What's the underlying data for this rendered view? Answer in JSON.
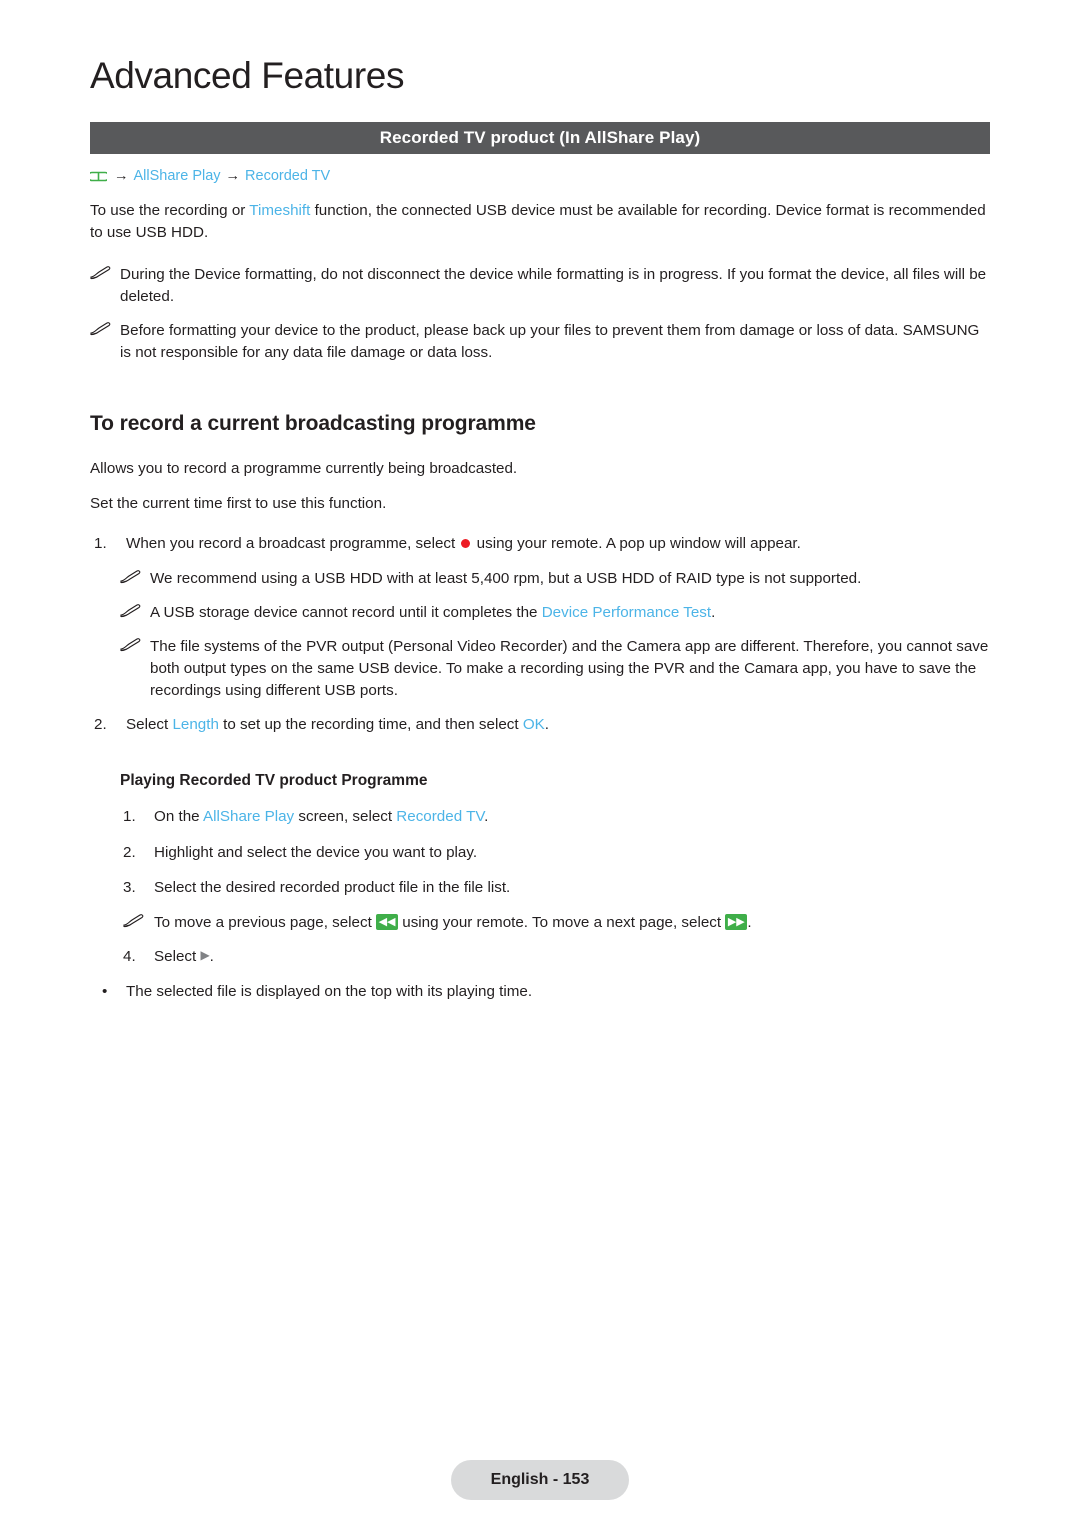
{
  "chapter": {
    "title": "Advanced Features"
  },
  "section": {
    "title": "Recorded TV product (In AllShare Play)"
  },
  "breadcrumb": {
    "icon": "menu-icon",
    "arrow1": "→",
    "item1": "AllShare Play",
    "arrow2": "→",
    "item2": "Recorded TV"
  },
  "intro": {
    "t1": "To use the recording or ",
    "link1": "Timeshift",
    "t2": " function, the connected USB device must be available for recording. Device format is recommended to use USB HDD."
  },
  "notes_top": [
    {
      "text": "During the Device formatting, do not disconnect the device while formatting is in progress. If you format the device, all files will be deleted."
    },
    {
      "text": "Before formatting your device to the product, please back up your files to prevent them from damage or loss of data. SAMSUNG is not responsible for any data file damage or data loss."
    }
  ],
  "record_section": {
    "heading": "To record a current broadcasting programme",
    "para1": "Allows you to record a programme currently being broadcasted.",
    "para2": "Set the current time first to use this function.",
    "step1": {
      "num": "1.",
      "t1": "When you record a broadcast programme, select ",
      "icon": "record-dot-icon",
      "t2": " using your remote. A pop up window will appear."
    },
    "note1": "We recommend using a USB HDD with at least 5,400 rpm, but a USB HDD of RAID type is not supported.",
    "note2": {
      "t1": "A USB storage device cannot record until it completes the ",
      "link": "Device Performance Test",
      "t2": "."
    },
    "note3": "The file systems of the PVR output (Personal Video Recorder) and the Camera app are different. Therefore, you cannot save both output types on the same USB device. To make a recording using the PVR and the Camara app, you have to save the recordings using different USB ports.",
    "step2": {
      "num": "2.",
      "t1": "Select ",
      "link1": "Length",
      "t2": " to set up the recording time, and then select ",
      "link2": "OK",
      "t3": "."
    }
  },
  "playing_section": {
    "heading": "Playing Recorded TV product Programme",
    "step1": {
      "num": "1.",
      "t1": "On the ",
      "link1": "AllShare Play",
      "t2": " screen, select ",
      "link2": "Recorded TV",
      "t3": "."
    },
    "step2": {
      "num": "2.",
      "text": "Highlight and select the device you want to play."
    },
    "step3": {
      "num": "3.",
      "text": "Select the desired recorded product file in the file list."
    },
    "note": {
      "t1": "To move a previous page, select ",
      "key1": "◀◀",
      "t2": " using your remote. To move a next page, select ",
      "key2": "▶▶",
      "t3": "."
    },
    "step4": {
      "num": "4.",
      "t1": "Select ",
      "icon": "play-icon",
      "t2": "."
    },
    "bullet": {
      "dot": "•",
      "text": "The selected file is displayed on the top with its playing time."
    }
  },
  "footer": {
    "label": "English - 153"
  },
  "colors": {
    "link": "#4cb4e7",
    "bar": "#58595b",
    "record": "#ed1c24",
    "key": "#3fae49",
    "footer_bg": "#d9dadb"
  }
}
